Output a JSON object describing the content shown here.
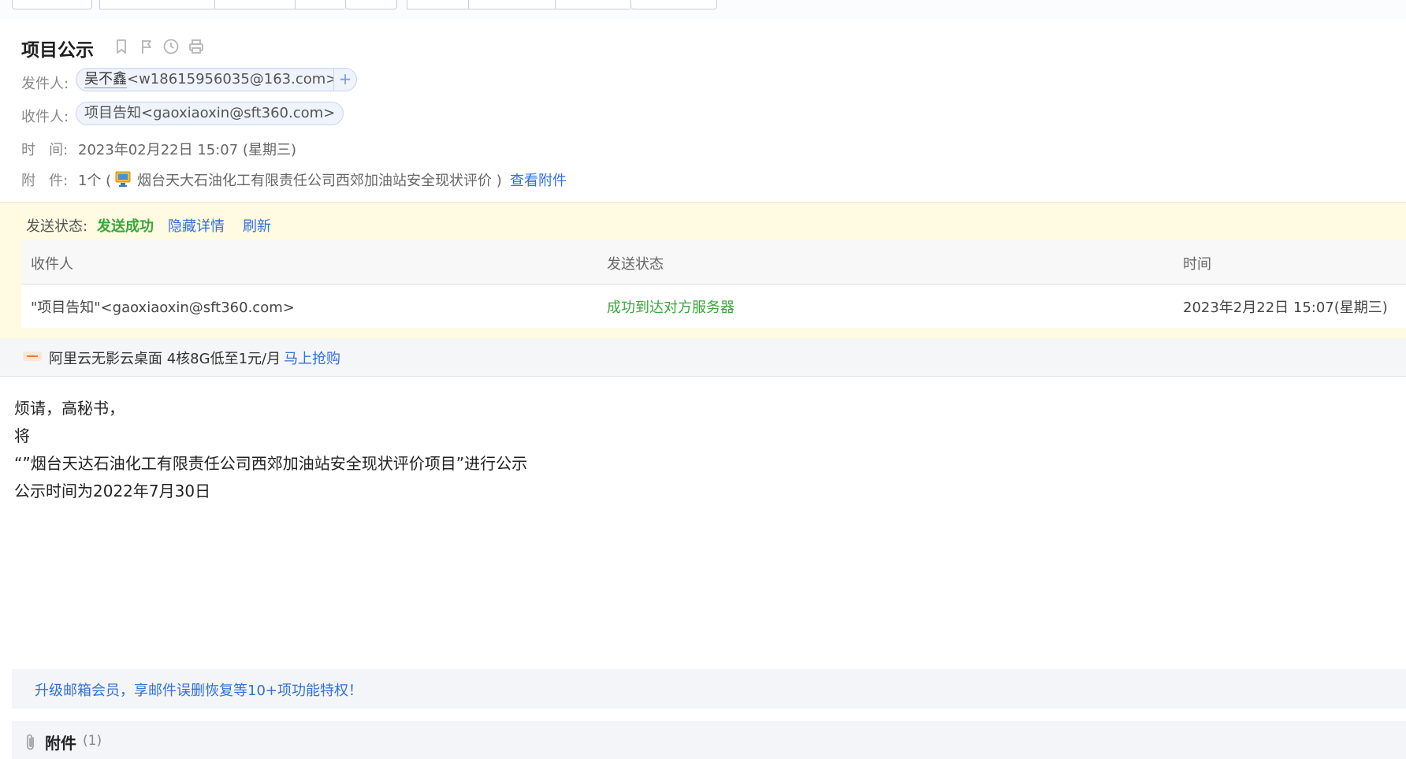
{
  "email": {
    "subject": "项目公示",
    "from_label": "发件人:",
    "from_name": "吴不鑫",
    "from_address": "<w18615956035@163.com>",
    "add_contact": "+",
    "to_label": "收件人:",
    "to_value": "项目告知<gaoxiaoxin@sft360.com>",
    "time_label": "时   间:",
    "time_value": "2023年02月22日 15:07 (星期三)",
    "attach_label": "附   件:",
    "attach_count": "1个 (",
    "attach_name": "烟台天大石油化工有限责任公司西郊加油站安全现状评价 )",
    "view_attach": "查看附件"
  },
  "send_status": {
    "label": "发送状态:",
    "value": "发送成功",
    "hide_details": "隐藏详情",
    "refresh": "刷新",
    "columns": [
      "收件人",
      "发送状态",
      "时间"
    ],
    "row": {
      "recipient": "\"项目告知\"<gaoxiaoxin@sft360.com>",
      "status": "成功到达对方服务器",
      "time": "2023年2月22日 15:07(星期三)"
    },
    "colors": {
      "success": "#3aa63a",
      "link": "#3370d8"
    }
  },
  "ad": {
    "text": "阿里云无影云桌面 4核8G低至1元/月",
    "link": "马上抢购"
  },
  "body": {
    "lines": [
      "烦请，高秘书，",
      "将",
      "“”烟台天达石油化工有限责任公司西郊加油站安全现状评价项目”进行公示",
      "公示时间为2022年7月30日"
    ]
  },
  "vip": {
    "text": "升级邮箱会员，享邮件误删恢复等10+项功能特权！"
  },
  "attachments": {
    "title": "附件",
    "count": "(1)"
  },
  "icons": [
    "bookmark-icon",
    "flag-icon",
    "clock-icon",
    "print-icon",
    "attachment-file-icon",
    "ad-logo-icon",
    "paperclip-icon"
  ]
}
